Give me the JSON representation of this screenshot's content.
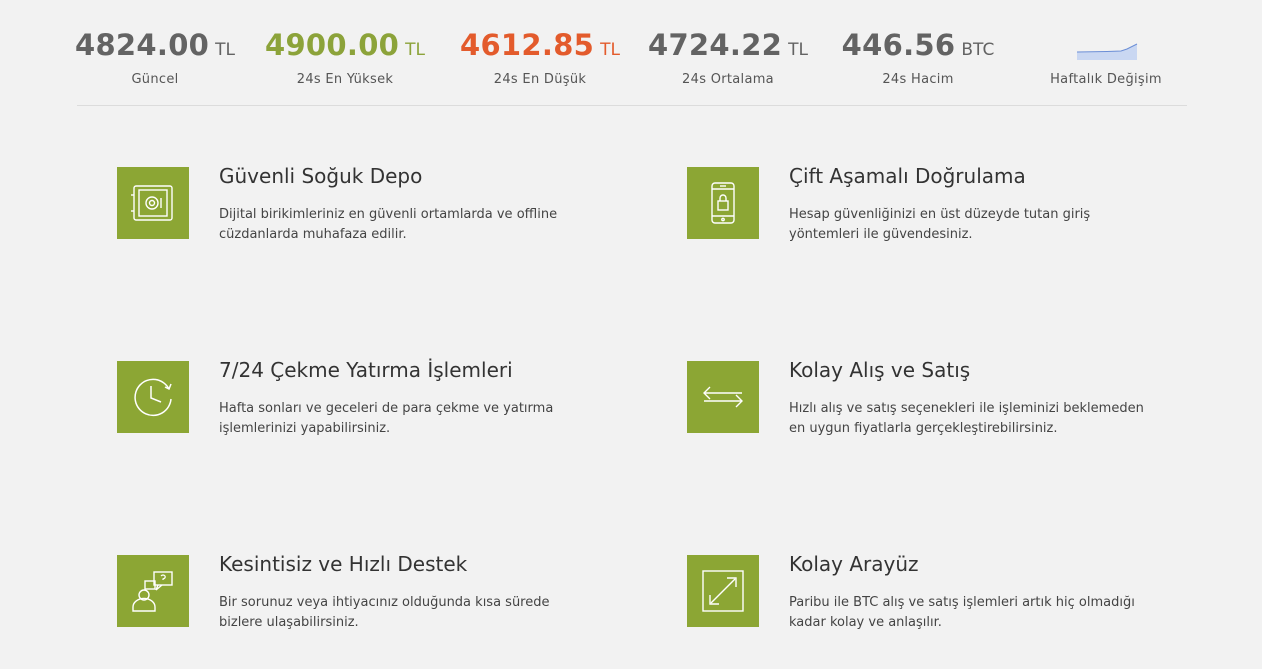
{
  "stats": [
    {
      "value": "4824.00",
      "unit": "TL",
      "label": "Güncel",
      "color": "#636363"
    },
    {
      "value": "4900.00",
      "unit": "TL",
      "label": "24s En Yüksek",
      "color": "#8ca33a"
    },
    {
      "value": "4612.85",
      "unit": "TL",
      "label": "24s En Düşük",
      "color": "#e35b2c"
    },
    {
      "value": "4724.22",
      "unit": "TL",
      "label": "24s Ortalama",
      "color": "#636363"
    },
    {
      "value": "446.56",
      "unit": "BTC",
      "label": "24s Hacim",
      "color": "#636363"
    }
  ],
  "weekly": {
    "label": "Haftalık Değişim",
    "trend": "up"
  },
  "features": [
    {
      "title": "Güvenli Soğuk Depo",
      "desc": "Dijital birikimleriniz en güvenli ortamlarda ve offline cüzdanlarda muhafaza edilir.",
      "icon": "safe-icon"
    },
    {
      "title": "Çift Aşamalı Doğrulama",
      "desc": "Hesap güvenliğinizi en üst düzeyde tutan giriş yöntemleri ile güvendesiniz.",
      "icon": "phone-lock-icon"
    },
    {
      "title": "7/24 Çekme Yatırma İşlemleri",
      "desc": "Hafta sonları ve geceleri de para çekme ve yatırma işlemlerinizi yapabilirsiniz.",
      "icon": "clock-icon"
    },
    {
      "title": "Kolay Alış ve Satış",
      "desc": "Hızlı alış ve satış seçenekleri ile işleminizi beklemeden en uygun fiyatlarla gerçekleştirebilirsiniz.",
      "icon": "exchange-arrows-icon"
    },
    {
      "title": "Kesintisiz ve Hızlı Destek",
      "desc": "Bir sorunuz veya ihtiyacınız olduğunda kısa sürede bizlere ulaşabilirsiniz.",
      "icon": "support-icon"
    },
    {
      "title": "Kolay Arayüz",
      "desc": "Paribu ile BTC alış ve satış işlemleri artık hiç olmadığı kadar kolay ve anlaşılır.",
      "icon": "expand-icon"
    }
  ]
}
